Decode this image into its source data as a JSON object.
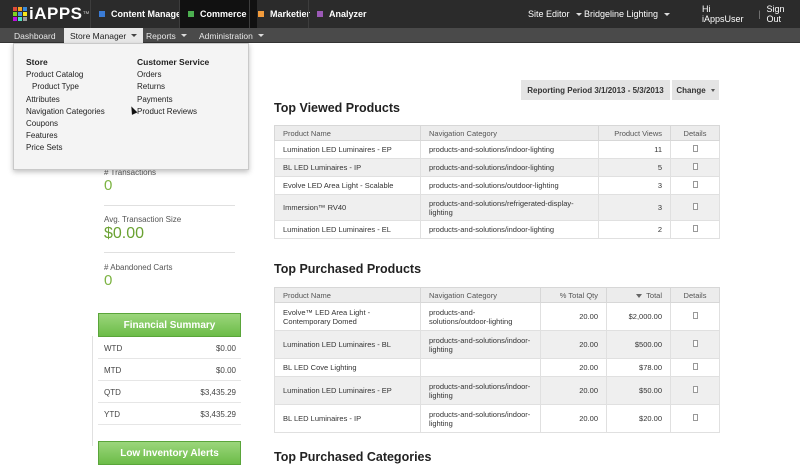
{
  "brand": {
    "name": "iAPPS",
    "tm": "™",
    "grid_colors": [
      "#e04b3a",
      "#f5a623",
      "#3b8ad8",
      "#7ed321",
      "#4a90e2",
      "#f8e71c",
      "#bd10e0",
      "#50e3c2",
      "#9b9b9b"
    ]
  },
  "products": [
    {
      "label": "Content Manager",
      "color": "#3a7bd5"
    },
    {
      "label": "Commerce",
      "color": "#4caf50"
    },
    {
      "label": "Marketier",
      "color": "#f39c3c"
    },
    {
      "label": "Analyzer",
      "color": "#9b59b6"
    }
  ],
  "top_right": {
    "site_editor": "Site Editor",
    "site": "Bridgeline Lighting",
    "greeting": "Hi iAppsUser",
    "separator": "|",
    "sign_out": "Sign Out"
  },
  "nav": {
    "items": [
      "Dashboard",
      "Store Manager",
      "Reports",
      "Administration"
    ]
  },
  "dropdown": {
    "store": {
      "heading": "Store",
      "items": [
        "Product Catalog",
        "Product Type",
        "Attributes",
        "Navigation Categories",
        "Coupons",
        "Features",
        "Price Sets"
      ]
    },
    "customer_service": {
      "heading": "Customer Service",
      "items": [
        "Orders",
        "Returns",
        "Payments",
        "Product Reviews"
      ]
    }
  },
  "stats": {
    "transactions_label": "# Transactions",
    "transactions_value": "0",
    "avg_label": "Avg. Transaction Size",
    "avg_value": "$0.00",
    "abandoned_label": "# Abandoned Carts",
    "abandoned_value": "0"
  },
  "financial_summary": {
    "title": "Financial Summary",
    "rows": [
      {
        "k": "WTD",
        "v": "$0.00"
      },
      {
        "k": "MTD",
        "v": "$0.00"
      },
      {
        "k": "QTD",
        "v": "$3,435.29"
      },
      {
        "k": "YTD",
        "v": "$3,435.29"
      }
    ]
  },
  "low_inventory": {
    "title": "Low Inventory Alerts"
  },
  "reporting": {
    "label": "Reporting Period 3/1/2013 - 5/3/2013",
    "change": "Change"
  },
  "top_viewed": {
    "title": "Top Viewed Products",
    "headers": [
      "Product Name",
      "Navigation Category",
      "Product Views",
      "Details"
    ],
    "rows": [
      [
        "Lumination LED Luminaires - EP",
        "products-and-solutions/indoor-lighting",
        "11"
      ],
      [
        "BL LED Luminaires - IP",
        "products-and-solutions/indoor-lighting",
        "5"
      ],
      [
        "Evolve LED Area Light - Scalable",
        "products-and-solutions/outdoor-lighting",
        "3"
      ],
      [
        "Immersion™ RV40",
        "products-and-solutions/refrigerated-display-lighting",
        "3"
      ],
      [
        "Lumination LED Luminaires - EL",
        "products-and-solutions/indoor-lighting",
        "2"
      ]
    ]
  },
  "top_purchased": {
    "title": "Top Purchased Products",
    "headers": [
      "Product Name",
      "Navigation Category",
      "% Total Qty",
      "Total",
      "Details"
    ],
    "rows": [
      [
        "Evolve™ LED Area Light - Contemporary Domed",
        "products-and-solutions/outdoor-lighting",
        "20.00",
        "$2,000.00"
      ],
      [
        "Lumination LED Luminaires - BL",
        "products-and-solutions/indoor-lighting",
        "20.00",
        "$500.00"
      ],
      [
        "BL LED Cove Lighting",
        "",
        "20.00",
        "$78.00"
      ],
      [
        "Lumination LED Luminaires - EP",
        "products-and-solutions/indoor-lighting",
        "20.00",
        "$50.00"
      ],
      [
        "BL LED Luminaires - IP",
        "products-and-solutions/indoor-lighting",
        "20.00",
        "$20.00"
      ]
    ]
  },
  "top_categories": {
    "title": "Top Purchased Categories"
  }
}
